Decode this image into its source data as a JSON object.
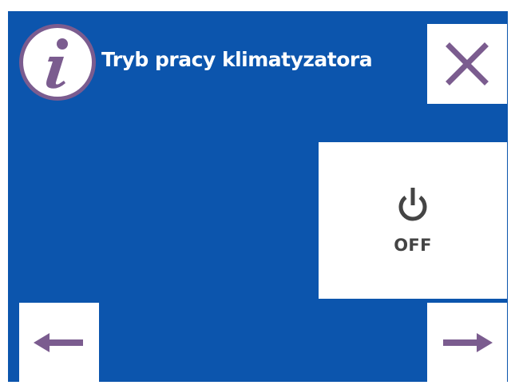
{
  "header": {
    "title": "Tryb pracy klimatyzatora",
    "info_icon": "info-icon",
    "close_icon": "close-icon"
  },
  "mode": {
    "icon": "power-icon",
    "state_label": "OFF"
  },
  "navigation": {
    "prev_icon": "arrow-left-icon",
    "next_icon": "arrow-right-icon"
  },
  "colors": {
    "background": "#0c55ad",
    "accent": "#7b5c8f",
    "panel": "#ffffff",
    "text_dark": "#444444"
  }
}
